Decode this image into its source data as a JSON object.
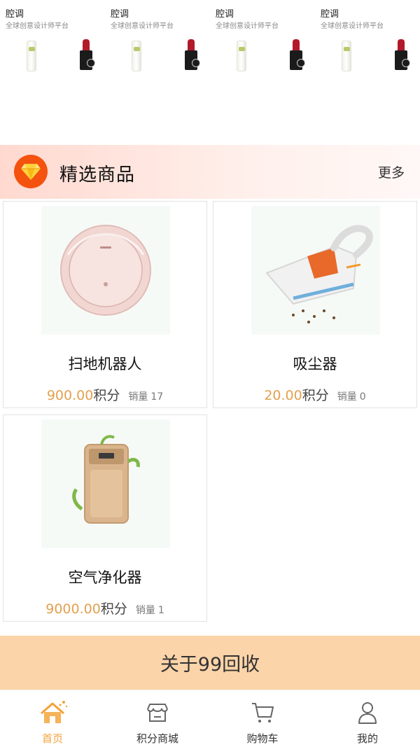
{
  "banner": {
    "cards": [
      {
        "title": "腔调",
        "subtitle": "全球创意设计师平台"
      },
      {
        "title": "腔调",
        "subtitle": "全球创意设计师平台"
      },
      {
        "title": "腔调",
        "subtitle": "全球创意设计师平台"
      },
      {
        "title": "腔调",
        "subtitle": "全球创意设计师平台"
      }
    ]
  },
  "featured": {
    "title": "精选商品",
    "more_label": "更多",
    "icon": "diamond-icon",
    "accent_color": "#f4520f"
  },
  "products": [
    {
      "name": "扫地机器人",
      "price": "900.00",
      "unit": "积分",
      "sales_label": "销量",
      "sales_count": "17",
      "image": "robot-vacuum"
    },
    {
      "name": "吸尘器",
      "price": "20.00",
      "unit": "积分",
      "sales_label": "销量",
      "sales_count": "0",
      "image": "handheld-vacuum"
    },
    {
      "name": "空气净化器",
      "price": "9000.00",
      "unit": "积分",
      "sales_label": "销量",
      "sales_count": "1",
      "image": "air-purifier"
    }
  ],
  "about": {
    "label": "关于99回收",
    "color": "#fcd4a9"
  },
  "nav": {
    "items": [
      {
        "label": "首页",
        "icon": "home-icon",
        "active": true
      },
      {
        "label": "积分商城",
        "icon": "store-icon",
        "active": false
      },
      {
        "label": "购物车",
        "icon": "cart-icon",
        "active": false
      },
      {
        "label": "我的",
        "icon": "user-icon",
        "active": false
      }
    ],
    "active_color": "#f4a23a"
  },
  "colors": {
    "price": "#e3a04f"
  }
}
